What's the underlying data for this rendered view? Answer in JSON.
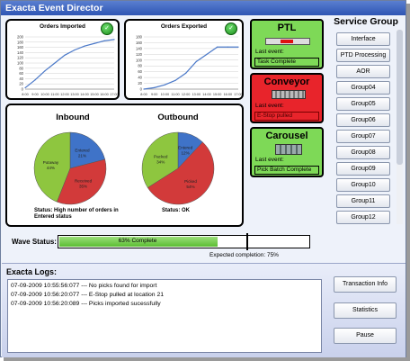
{
  "window": {
    "title": "Exacta Event Director"
  },
  "charts": {
    "orders_imported": {
      "title": "Orders Imported",
      "ok_symbol": "✓"
    },
    "orders_exported": {
      "title": "Orders Exported",
      "ok_symbol": "✓"
    },
    "inbound": {
      "title": "Inbound",
      "status": "Status: High number of orders in Entered status",
      "slices": [
        {
          "name": "Entered",
          "value": 21,
          "color": "#3f73c8"
        },
        {
          "name": "Received",
          "value": 35,
          "color": "#d23a3a"
        },
        {
          "name": "Putaway",
          "value": 44,
          "color": "#8ec63f"
        }
      ]
    },
    "outbound": {
      "title": "Outbound",
      "status": "Status: OK",
      "slices": [
        {
          "name": "Entered",
          "value": 12,
          "color": "#3f73c8"
        },
        {
          "name": "Picked",
          "value": 54,
          "color": "#d23a3a"
        },
        {
          "name": "Packed",
          "value": 34,
          "color": "#8ec63f"
        }
      ]
    }
  },
  "chart_data": [
    {
      "type": "line",
      "title": "Orders Imported",
      "x": [
        "8:00",
        "9:00",
        "10:00",
        "11:00",
        "12:00",
        "13:00",
        "14:00",
        "15:00",
        "16:00",
        "17:00"
      ],
      "xlabels": [
        "8:00",
        "9:00",
        "10:00",
        "11:00",
        "12:00",
        "13:00",
        "14:00",
        "15:00",
        "16:00",
        "17:00"
      ],
      "y": [
        5,
        35,
        70,
        100,
        130,
        150,
        165,
        175,
        185,
        190
      ],
      "ylim": [
        0,
        200
      ],
      "yticks": [
        0,
        20,
        40,
        60,
        80,
        100,
        120,
        140,
        160,
        180,
        200
      ],
      "grid": true
    },
    {
      "type": "line",
      "title": "Orders Exported",
      "x": [
        "8:00",
        "9:00",
        "10:00",
        "11:00",
        "12:00",
        "13:00",
        "14:00",
        "15:00",
        "16:00",
        "17:00"
      ],
      "xlabels": [
        "8:00",
        "9:00",
        "10:00",
        "11:00",
        "12:00",
        "13:00",
        "14:00",
        "15:00",
        "16:00",
        "17:00"
      ],
      "y": [
        0,
        5,
        15,
        30,
        55,
        95,
        120,
        145,
        145,
        145
      ],
      "ylim": [
        0,
        180
      ],
      "yticks": [
        0,
        20,
        40,
        60,
        80,
        100,
        120,
        140,
        160,
        180
      ],
      "grid": true
    },
    {
      "type": "pie",
      "title": "Inbound",
      "labels": [
        "Entered",
        "Received",
        "Putaway"
      ],
      "values": [
        21,
        35,
        44
      ],
      "value_labels": [
        "21%",
        "35%",
        "44%"
      ]
    },
    {
      "type": "pie",
      "title": "Outbound",
      "labels": [
        "Entered",
        "Picked",
        "Packed"
      ],
      "values": [
        12,
        54,
        34
      ],
      "value_labels": [
        "12%",
        "54%",
        "34%"
      ]
    }
  ],
  "devices": [
    {
      "name": "PTL",
      "event_label": "Last event:",
      "event": "Task Complete",
      "bg": "#7ed957",
      "box_color": "#000000"
    },
    {
      "name": "Conveyor",
      "event_label": "Last event:",
      "event": "E-Stop pulled",
      "bg": "#e8242b",
      "box_color": "#7a0000"
    },
    {
      "name": "Carousel",
      "event_label": "Last event:",
      "event": "Pick Batch Complete",
      "bg": "#7ed957",
      "box_color": "#000000"
    }
  ],
  "service_group": {
    "title": "Service Group",
    "buttons": [
      "Interface",
      "PTD Processing",
      "AOR",
      "Group04",
      "Group05",
      "Group06",
      "Group07",
      "Group08",
      "Group09",
      "Group10",
      "Group11",
      "Group12"
    ]
  },
  "wave": {
    "label": "Wave Status:",
    "progress_text": "63% Complete",
    "progress": 0.63,
    "expected_fraction": 0.75,
    "expected_text": "Expected completion: 75%"
  },
  "logs": {
    "title": "Exacta Logs:",
    "entries": [
      "07-09-2009 10:55:56:077 --- No picks found for import",
      "07-09-2009 10:56:20:077 --- E-Stop pulled at location 21",
      "07-09-2009 10:56:20:089 --- Picks imported sucessfully"
    ]
  },
  "actions": {
    "transaction": "Transaction Info",
    "statistics": "Statistics",
    "pause": "Pause"
  }
}
